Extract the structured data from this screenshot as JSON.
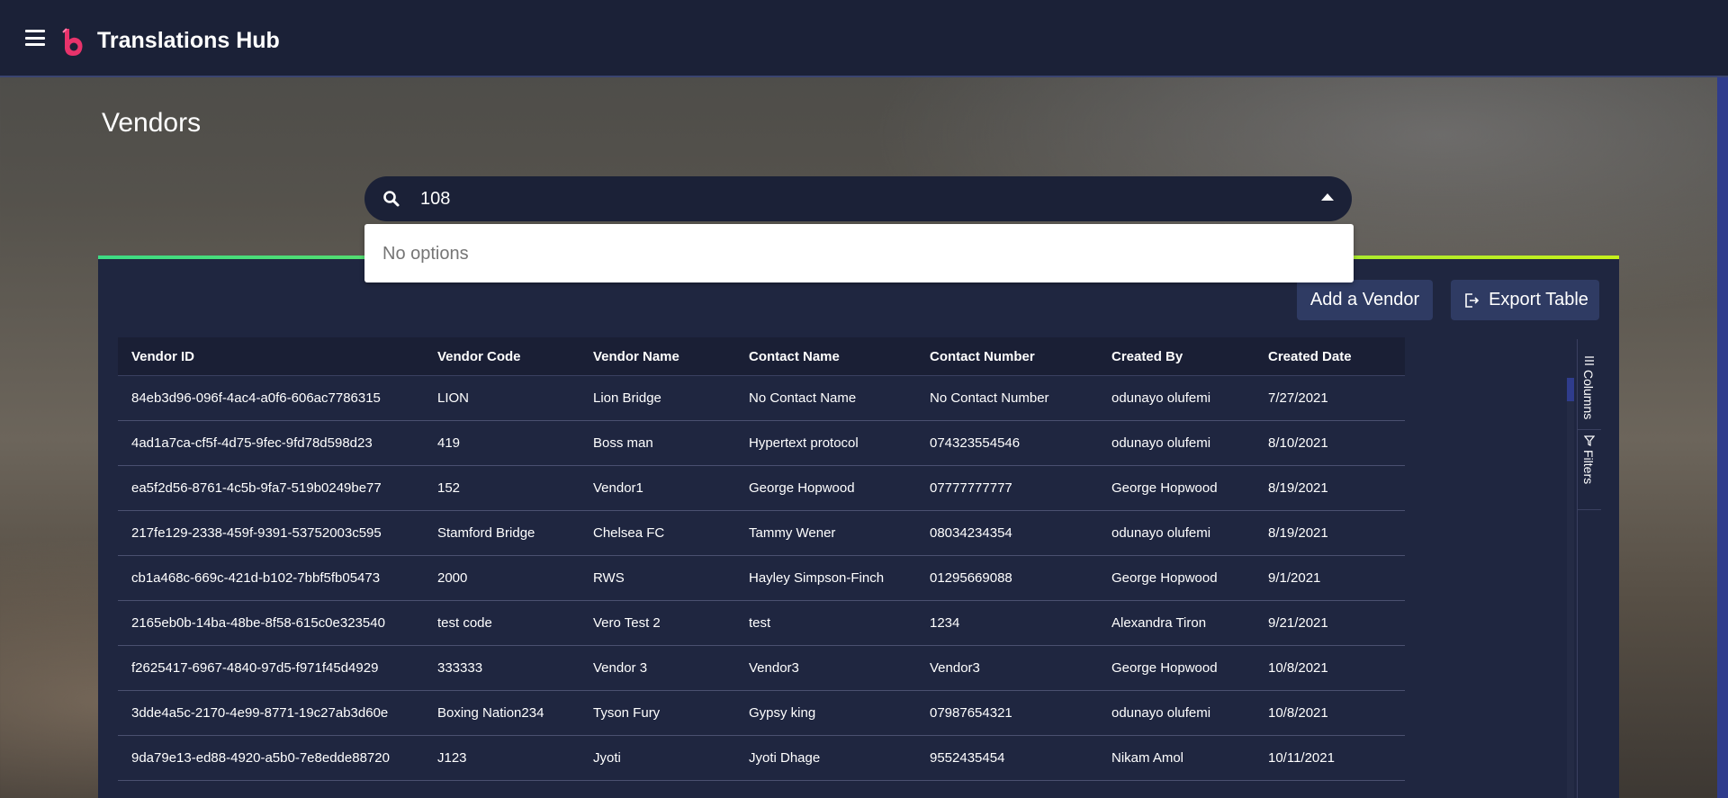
{
  "app": {
    "title": "Translations Hub"
  },
  "page": {
    "title": "Vendors"
  },
  "search": {
    "value": "108",
    "no_options_text": "No options"
  },
  "toolbar": {
    "add_label": "Add a Vendor",
    "export_label": "Export Table"
  },
  "side_panel": {
    "columns_label": "Columns",
    "filters_label": "Filters"
  },
  "table": {
    "columns": [
      "Vendor ID",
      "Vendor Code",
      "Vendor Name",
      "Contact Name",
      "Contact Number",
      "Created By",
      "Created Date"
    ],
    "rows": [
      [
        "84eb3d96-096f-4ac4-a0f6-606ac7786315",
        "LION",
        "Lion Bridge",
        "No Contact Name",
        "No Contact Number",
        "odunayo olufemi",
        "7/27/2021"
      ],
      [
        "4ad1a7ca-cf5f-4d75-9fec-9fd78d598d23",
        "419",
        "Boss man",
        "Hypertext protocol",
        "074323554546",
        "odunayo olufemi",
        "8/10/2021"
      ],
      [
        "ea5f2d56-8761-4c5b-9fa7-519b0249be77",
        "152",
        "Vendor1",
        "George Hopwood",
        "07777777777",
        "George Hopwood",
        "8/19/2021"
      ],
      [
        "217fe129-2338-459f-9391-53752003c595",
        "Stamford Bridge",
        "Chelsea FC",
        "Tammy Wener",
        "08034234354",
        "odunayo olufemi",
        "8/19/2021"
      ],
      [
        "cb1a468c-669c-421d-b102-7bbf5fb05473",
        "2000",
        "RWS",
        "Hayley Simpson-Finch",
        "01295669088",
        "George Hopwood",
        "9/1/2021"
      ],
      [
        "2165eb0b-14ba-48be-8f58-615c0e323540",
        "test code",
        "Vero Test 2",
        "test",
        "1234",
        "Alexandra Tiron",
        "9/21/2021"
      ],
      [
        "f2625417-6967-4840-97d5-f971f45d4929",
        "333333",
        "Vendor 3",
        "Vendor3",
        "Vendor3",
        "George Hopwood",
        "10/8/2021"
      ],
      [
        "3dde4a5c-2170-4e99-8771-19c27ab3d60e",
        "Boxing Nation234",
        "Tyson Fury",
        "Gypsy king",
        "07987654321",
        "odunayo olufemi",
        "10/8/2021"
      ],
      [
        "9da79e13-ed88-4920-a5b0-7e8edde88720",
        "J123",
        "Jyoti",
        "Jyoti Dhage",
        "9552435454",
        "Nikam Amol",
        "10/11/2021"
      ]
    ]
  },
  "colors": {
    "appbar": "#1b2137",
    "panel": "#1f2640",
    "accent_start": "#3ddc84",
    "accent_end": "#c6f01c",
    "button": "#2f3b63",
    "logo": "#e8336b"
  },
  "icons": {
    "menu": "hamburger-icon",
    "logo": "brand-logo",
    "search": "search-icon",
    "dropdown": "caret-up-icon",
    "export": "export-icon",
    "columns": "columns-icon",
    "filters": "filter-icon"
  }
}
